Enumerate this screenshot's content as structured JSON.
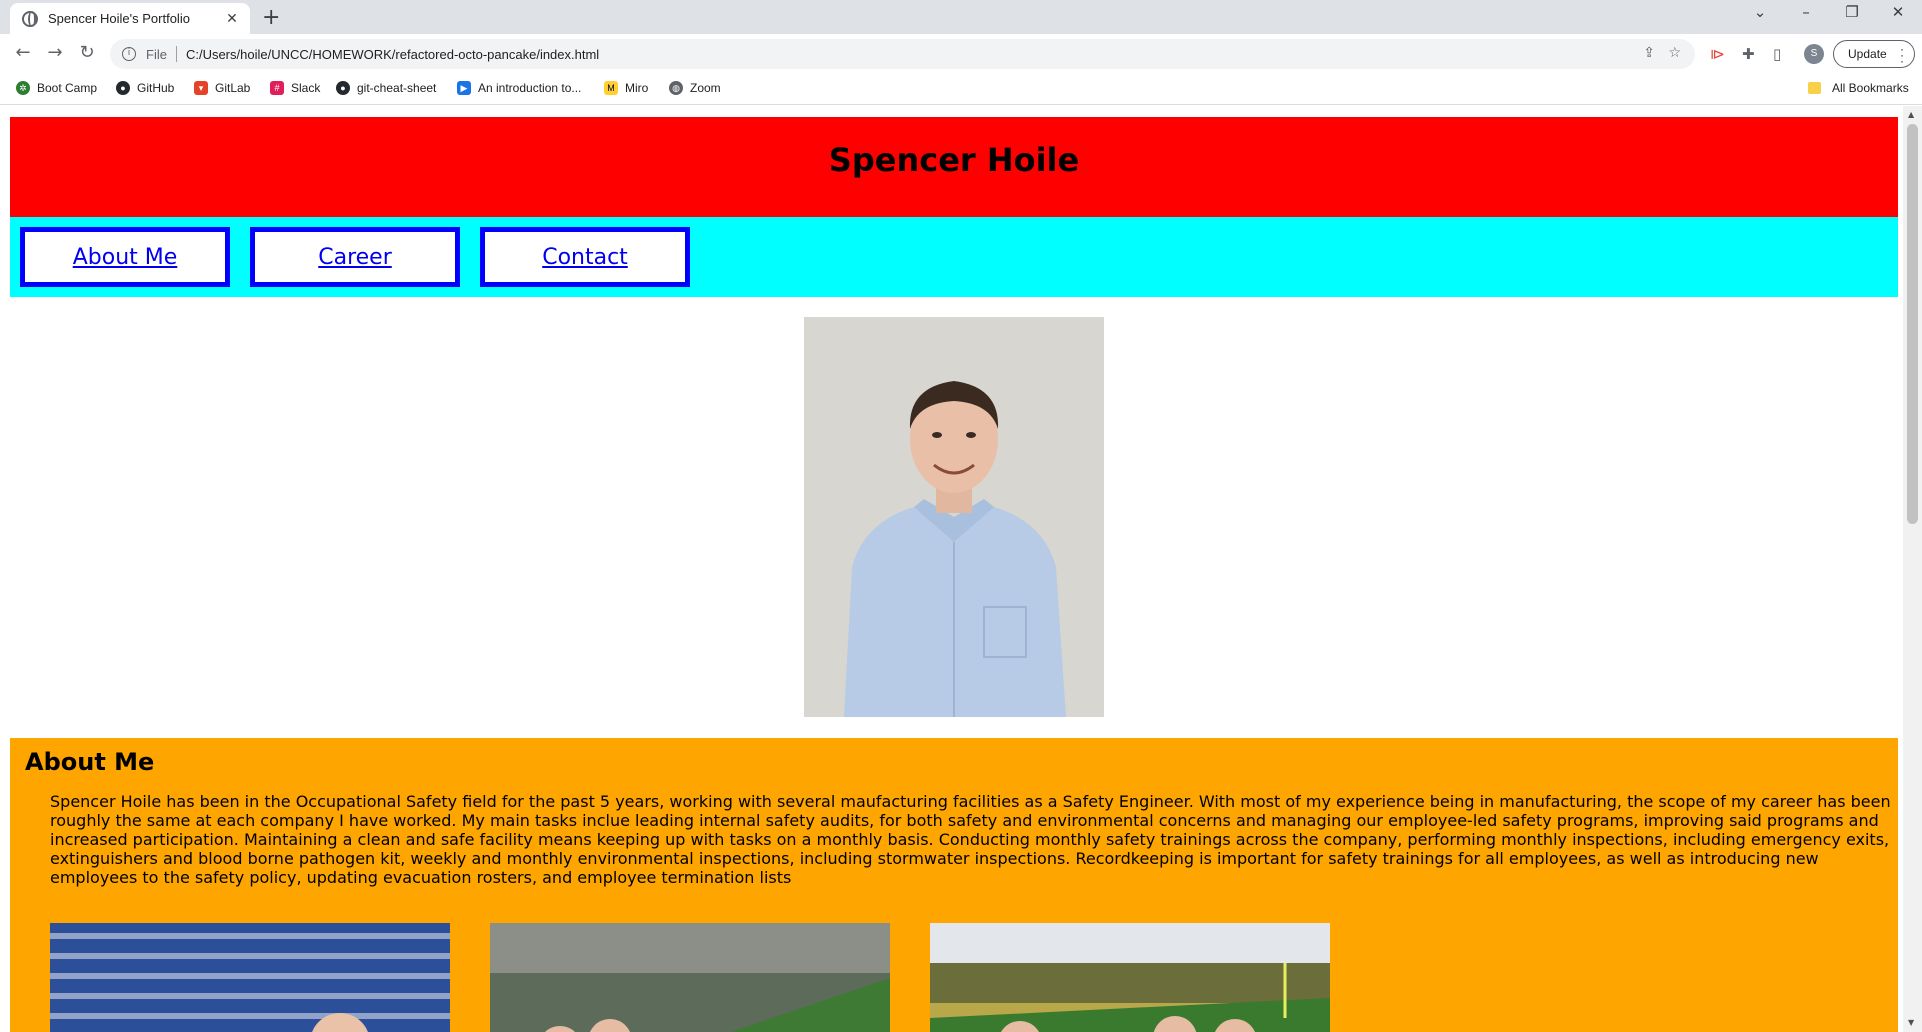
{
  "browser": {
    "tab_title": "Spencer Hoile's Portfolio",
    "tab_close": "✕",
    "new_tab": "+",
    "address_scheme": "File",
    "address_url": "C:/Users/hoile/UNCC/HOMEWORK/refactored-octo-pancake/index.html",
    "avatar_letter": "S",
    "update_label": "Update",
    "bookmarks": [
      {
        "label": "Boot Camp",
        "icon": "bootcamp-icon",
        "color": "#2e7d32"
      },
      {
        "label": "GitHub",
        "icon": "github-icon",
        "color": "#24292f"
      },
      {
        "label": "GitLab",
        "icon": "gitlab-icon",
        "color": "#e24329"
      },
      {
        "label": "Slack",
        "icon": "slack-icon",
        "color": "#e01e5a"
      },
      {
        "label": "git-cheat-sheet",
        "icon": "github-icon",
        "color": "#24292f"
      },
      {
        "label": "An introduction to...",
        "icon": "play-icon",
        "color": "#1a73e8"
      },
      {
        "label": "Miro",
        "icon": "miro-icon",
        "color": "#050038"
      },
      {
        "label": "Zoom",
        "icon": "globe-icon",
        "color": "#5f6368"
      }
    ],
    "all_bookmarks": "All Bookmarks"
  },
  "page": {
    "header_title": "Spencer Hoile",
    "nav": [
      "About Me",
      "Career",
      "Contact"
    ],
    "about_heading": "About Me",
    "about_text": "Spencer Hoile has been in the Occupational Safety field for the past 5 years, working with several maufacturing facilities as a Safety Engineer. With most of my experience being in manufacturing, the scope of my career has been roughly the same at each company I have worked. My main tasks inclue leading internal safety audits, for both safety and environmental concerns and managing our employee-led safety programs, improving said programs and increased participation. Maintaining a clean and safe facility means keeping up with tasks on a monthly basis. Conducting monthly safety trainings across the company, performing monthly inspections, including emergency exits, extinguishers and blood borne pathogen kit, weekly and monthly environmental inspections, including stormwater inspections. Recordkeeping is important for safety trainings for all employees, as well as introducing new employees to the safety policy, updating evacuation rosters, and employee termination lists",
    "colors": {
      "header": "#ff0000",
      "nav": "#00ffff",
      "nav_border": "#0000ff",
      "about": "#ffa500"
    }
  }
}
